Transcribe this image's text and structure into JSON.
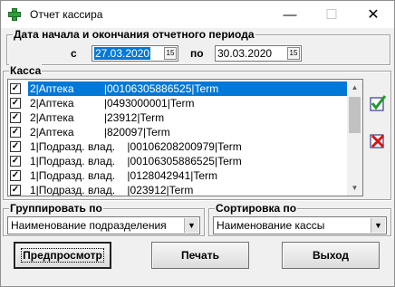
{
  "window": {
    "title": "Отчет кассира",
    "icon": "green-cross-icon"
  },
  "period": {
    "legend": "Дата начала и окончания отчетного периода",
    "from_label": "с",
    "from_value": "27.03.2020",
    "to_label": "по",
    "to_value": "30.03.2020"
  },
  "kassa": {
    "legend": "Касса",
    "rows": [
      {
        "text": "2|Аптека          |00106305886525|Term",
        "checked": true,
        "selected": true
      },
      {
        "text": "2|Аптека          |0493000001|Term",
        "checked": true,
        "selected": false
      },
      {
        "text": "2|Аптека          |23912|Term",
        "checked": true,
        "selected": false
      },
      {
        "text": "2|Аптека          |820097|Term",
        "checked": true,
        "selected": false
      },
      {
        "text": "1|Подразд. влад.    |00106208200979|Term",
        "checked": true,
        "selected": false
      },
      {
        "text": "1|Подразд. влад.    |00106305886525|Term",
        "checked": true,
        "selected": false
      },
      {
        "text": "1|Подразд. влад.    |0128042941|Term",
        "checked": true,
        "selected": false
      },
      {
        "text": "1|Подразд. влад.    |023912|Term",
        "checked": true,
        "selected": false
      }
    ],
    "select_all_icon": "check-all-icon",
    "clear_all_icon": "uncheck-all-icon"
  },
  "grouping": {
    "legend": "Группировать по",
    "value": "Наименование подразделения"
  },
  "sorting": {
    "legend": "Сортировка по",
    "value": "Наименование кассы"
  },
  "buttons": {
    "preview": "Предпросмотр",
    "print": "Печать",
    "exit": "Выход"
  },
  "colors": {
    "selection": "#0078d7",
    "window_bg": "#f0f0f0"
  }
}
